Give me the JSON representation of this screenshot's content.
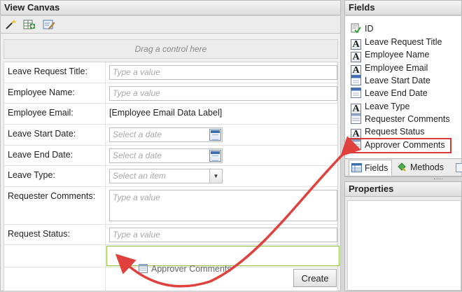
{
  "canvas": {
    "title": "View Canvas",
    "drop_hint": "Drag a control here",
    "create_label": "Create"
  },
  "toolbar": {
    "icons": [
      "magic-wand-icon",
      "add-table-icon",
      "edit-form-icon"
    ]
  },
  "form": {
    "rows": [
      {
        "label": "Leave Request Title:",
        "control": "text",
        "placeholder": "Type a value"
      },
      {
        "label": "Employee Name:",
        "control": "text",
        "placeholder": "Type a value"
      },
      {
        "label": "Employee Email:",
        "control": "data-label",
        "value": "[Employee Email Data Label]"
      },
      {
        "label": "Leave Start Date:",
        "control": "date",
        "placeholder": "Select a date"
      },
      {
        "label": "Leave End Date:",
        "control": "date",
        "placeholder": "Select a date"
      },
      {
        "label": "Leave Type:",
        "control": "select",
        "placeholder": "Select an item"
      },
      {
        "label": "Requester Comments:",
        "control": "textarea",
        "placeholder": "Type a value"
      },
      {
        "label": "Request Status:",
        "control": "text",
        "placeholder": "Type a value"
      }
    ]
  },
  "drag_ghost": {
    "label": "Approver Comments"
  },
  "fields": {
    "title": "Fields",
    "items": [
      {
        "label": "ID",
        "icon": "id-check-icon"
      },
      {
        "label": "Leave Request Title",
        "icon": "text-field-icon"
      },
      {
        "label": "Employee Name",
        "icon": "text-field-icon"
      },
      {
        "label": "Employee Email",
        "icon": "text-field-icon"
      },
      {
        "label": "Leave Start Date",
        "icon": "date-field-icon"
      },
      {
        "label": "Leave End Date",
        "icon": "date-field-icon"
      },
      {
        "label": "Leave Type",
        "icon": "text-field-icon"
      },
      {
        "label": "Requester Comments",
        "icon": "memo-field-icon"
      },
      {
        "label": "Request Status",
        "icon": "text-field-icon"
      },
      {
        "label": "Approver Comments",
        "icon": "memo-field-icon"
      }
    ],
    "highlighted": "Approver Comments"
  },
  "tabs": [
    {
      "label": "Fields",
      "icon": "table-icon",
      "active": true
    },
    {
      "label": "Methods",
      "icon": "methods-icon",
      "active": false
    }
  ],
  "properties": {
    "title": "Properties"
  },
  "colors": {
    "highlight": "#d63a36",
    "drop_target": "#8fc13a",
    "arrow": "#e0413c"
  }
}
